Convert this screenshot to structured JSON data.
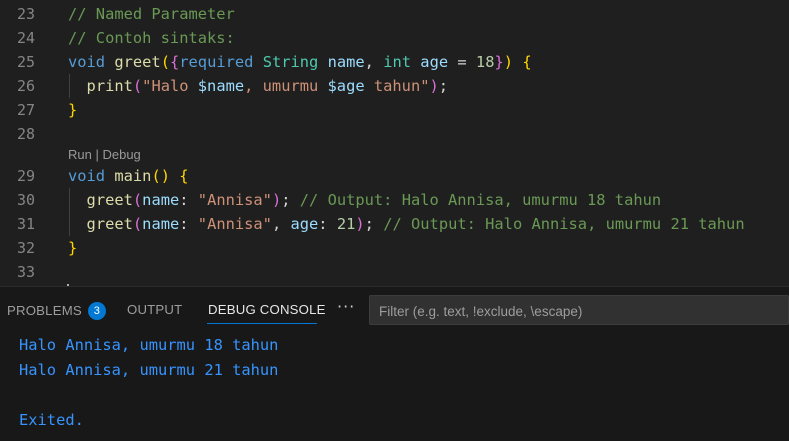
{
  "editor": {
    "lines": [
      {
        "num": "23",
        "tokens": [
          {
            "t": "// Named Parameter",
            "c": "c-cmt"
          }
        ]
      },
      {
        "num": "24",
        "tokens": [
          {
            "t": "// Contoh sintaks:",
            "c": "c-cmt"
          }
        ]
      },
      {
        "num": "25",
        "tokens": [
          {
            "t": "void",
            "c": "c-kw"
          },
          {
            "t": " ",
            "c": ""
          },
          {
            "t": "greet",
            "c": "c-fn"
          },
          {
            "t": "(",
            "c": "c-br1"
          },
          {
            "t": "{",
            "c": "c-br2"
          },
          {
            "t": "required",
            "c": "c-kw"
          },
          {
            "t": " ",
            "c": ""
          },
          {
            "t": "String",
            "c": "c-type"
          },
          {
            "t": " ",
            "c": ""
          },
          {
            "t": "name",
            "c": "c-var"
          },
          {
            "t": ", ",
            "c": "c-pun"
          },
          {
            "t": "int",
            "c": "c-type"
          },
          {
            "t": " ",
            "c": ""
          },
          {
            "t": "age",
            "c": "c-var"
          },
          {
            "t": " = ",
            "c": "c-pun"
          },
          {
            "t": "18",
            "c": "c-num"
          },
          {
            "t": "}",
            "c": "c-br2"
          },
          {
            "t": ")",
            "c": "c-br1"
          },
          {
            "t": " ",
            "c": ""
          },
          {
            "t": "{",
            "c": "c-br1"
          }
        ]
      },
      {
        "num": "26",
        "guide": true,
        "tokens": [
          {
            "t": "  ",
            "c": ""
          },
          {
            "t": "print",
            "c": "c-fn"
          },
          {
            "t": "(",
            "c": "c-br2"
          },
          {
            "t": "\"Halo ",
            "c": "c-str"
          },
          {
            "t": "$name",
            "c": "c-var"
          },
          {
            "t": ", umurmu ",
            "c": "c-str"
          },
          {
            "t": "$age",
            "c": "c-var"
          },
          {
            "t": " tahun\"",
            "c": "c-str"
          },
          {
            "t": ")",
            "c": "c-br2"
          },
          {
            "t": ";",
            "c": "c-pun"
          }
        ]
      },
      {
        "num": "27",
        "tokens": [
          {
            "t": "}",
            "c": "c-br1"
          }
        ]
      },
      {
        "num": "28",
        "tokens": []
      },
      {
        "num": "29",
        "tokens": [
          {
            "t": "void",
            "c": "c-kw"
          },
          {
            "t": " ",
            "c": ""
          },
          {
            "t": "main",
            "c": "c-fn"
          },
          {
            "t": "()",
            "c": "c-br1"
          },
          {
            "t": " ",
            "c": ""
          },
          {
            "t": "{",
            "c": "c-br1"
          }
        ]
      },
      {
        "num": "30",
        "guide": true,
        "tokens": [
          {
            "t": "  ",
            "c": ""
          },
          {
            "t": "greet",
            "c": "c-fn"
          },
          {
            "t": "(",
            "c": "c-br2"
          },
          {
            "t": "name",
            "c": "c-var"
          },
          {
            "t": ": ",
            "c": "c-pun"
          },
          {
            "t": "\"Annisa\"",
            "c": "c-str"
          },
          {
            "t": ")",
            "c": "c-br2"
          },
          {
            "t": "; ",
            "c": "c-pun"
          },
          {
            "t": "// Output: Halo Annisa, umurmu 18 tahun",
            "c": "c-cmt"
          }
        ]
      },
      {
        "num": "31",
        "guide": true,
        "tokens": [
          {
            "t": "  ",
            "c": ""
          },
          {
            "t": "greet",
            "c": "c-fn"
          },
          {
            "t": "(",
            "c": "c-br2"
          },
          {
            "t": "name",
            "c": "c-var"
          },
          {
            "t": ": ",
            "c": "c-pun"
          },
          {
            "t": "\"Annisa\"",
            "c": "c-str"
          },
          {
            "t": ", ",
            "c": "c-pun"
          },
          {
            "t": "age",
            "c": "c-var"
          },
          {
            "t": ": ",
            "c": "c-pun"
          },
          {
            "t": "21",
            "c": "c-num"
          },
          {
            "t": ")",
            "c": "c-br2"
          },
          {
            "t": "; ",
            "c": "c-pun"
          },
          {
            "t": "// Output: Halo Annisa, umurmu 21 tahun",
            "c": "c-cmt"
          }
        ]
      },
      {
        "num": "32",
        "tokens": [
          {
            "t": "}",
            "c": "c-br1"
          }
        ]
      },
      {
        "num": "33",
        "tokens": []
      }
    ],
    "codelens": {
      "run": "Run",
      "sep": " | ",
      "debug": "Debug"
    }
  },
  "panel": {
    "tabs": {
      "problems": "PROBLEMS",
      "problems_count": "3",
      "output": "OUTPUT",
      "debug_console": "DEBUG CONSOLE"
    },
    "more_icon": "ellipsis-icon",
    "filter_placeholder": "Filter (e.g. text, !exclude, \\escape)",
    "output_lines": [
      "Halo Annisa, umurmu 18 tahun",
      "Halo Annisa, umurmu 21 tahun",
      "",
      "Exited."
    ]
  },
  "colors": {
    "background": "#1f1f1f",
    "panel": "#181818",
    "accent": "#0078d4",
    "console_text": "#3794ff"
  }
}
